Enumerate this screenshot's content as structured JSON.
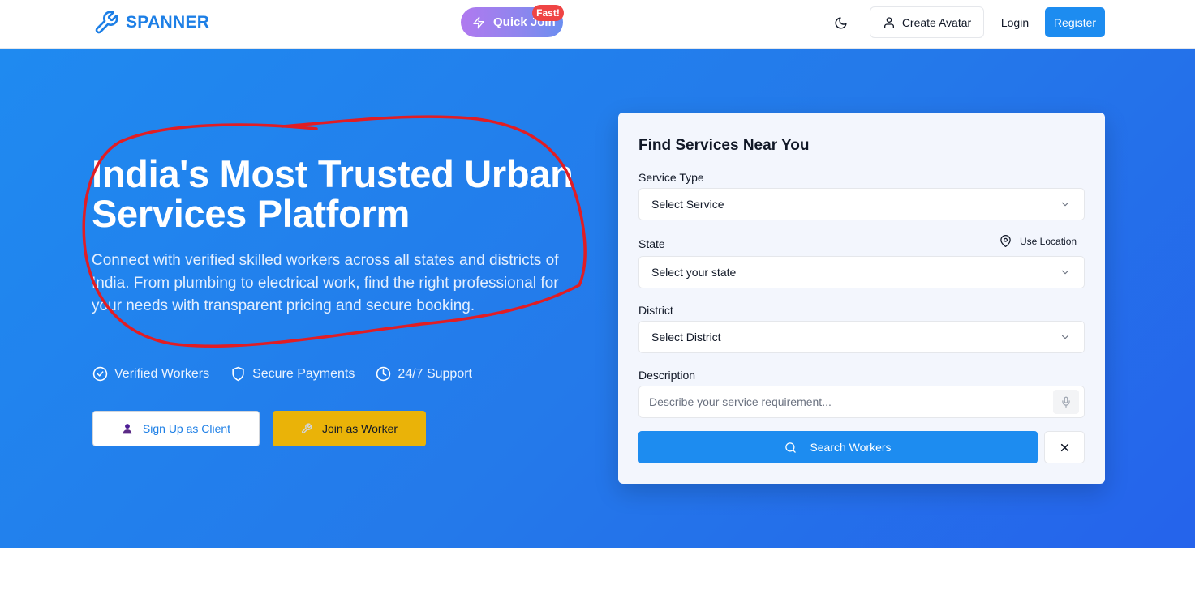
{
  "header": {
    "brand": "SPANNER",
    "brand_icon": "wrench-icon",
    "quick_join_label": "Quick Join",
    "quick_join_badge": "Fast!",
    "theme_icon": "moon-icon",
    "create_avatar_label": "Create Avatar",
    "login_label": "Login",
    "register_label": "Register",
    "colors": {
      "brand": "#1d7fe6",
      "register_bg": "#1d8cf0",
      "badge": "#ef4444"
    }
  },
  "hero": {
    "title": "India's Most Trusted Urban Services Platform",
    "description": "Connect with verified skilled workers across all states and districts of India. From plumbing to electrical work, find the right professional for your needs with transparent pricing and secure booking.",
    "features": [
      {
        "label": "Verified Workers",
        "icon": "check-circle-icon"
      },
      {
        "label": "Secure Payments",
        "icon": "shield-icon"
      },
      {
        "label": "24/7 Support",
        "icon": "clock-icon"
      }
    ],
    "client_button": "Sign Up as Client",
    "worker_button": "Join as Worker",
    "colors": {
      "background": "#2479ea",
      "worker_button": "#eab308"
    }
  },
  "search_card": {
    "title": "Find Services Near You",
    "service_type": {
      "label": "Service Type",
      "value": "Select Service"
    },
    "state": {
      "label": "State",
      "value": "Select your state",
      "use_location": "Use Location"
    },
    "district": {
      "label": "District",
      "value": "Select District"
    },
    "description": {
      "label": "Description",
      "placeholder": "Describe your service requirement..."
    },
    "search_button": "Search Workers",
    "clear_icon": "close-icon"
  },
  "annotation": {
    "type": "freehand-circle",
    "color": "#e11d24"
  }
}
